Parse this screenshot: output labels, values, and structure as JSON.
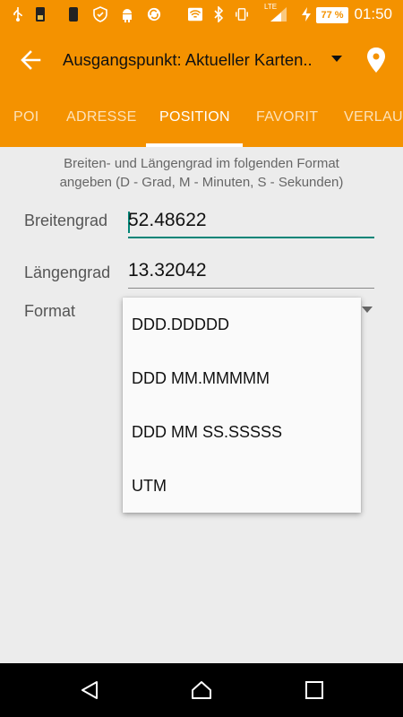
{
  "status_bar": {
    "battery": "77 %",
    "network": "LTE",
    "time": "01:50",
    "icons": [
      "usb-icon",
      "sd-card-icon",
      "phone-icon",
      "shield-icon",
      "android-icon",
      "sync-icon",
      "wifi-icon",
      "bluetooth-icon",
      "vibrate-icon",
      "signal-icon",
      "charging-icon"
    ]
  },
  "toolbar": {
    "title": "Ausgangspunkt: Aktueller Karten..",
    "back_icon": "arrow-left-icon",
    "location_icon": "map-pin-icon"
  },
  "tabs": [
    {
      "label": "POI",
      "active": false
    },
    {
      "label": "ADRESSE",
      "active": false
    },
    {
      "label": "POSITION",
      "active": true
    },
    {
      "label": "FAVORIT",
      "active": false
    },
    {
      "label": "VERLAU",
      "active": false
    }
  ],
  "form": {
    "hint_line1": "Breiten- und Längengrad im folgenden Format",
    "hint_line2": "angeben (D - Grad, M - Minuten, S - Sekunden)",
    "latitude_label": "Breitengrad",
    "latitude_value": "52.48622",
    "longitude_label": "Längengrad",
    "longitude_value": "13.32042",
    "format_label": "Format"
  },
  "format_dropdown": {
    "options": [
      "DDD.DDDDD",
      "DDD MM.MMMMM",
      "DDD MM SS.SSSSS",
      "UTM"
    ]
  },
  "colors": {
    "accent": "#f49200",
    "teal": "#008577",
    "background": "#ececec"
  }
}
